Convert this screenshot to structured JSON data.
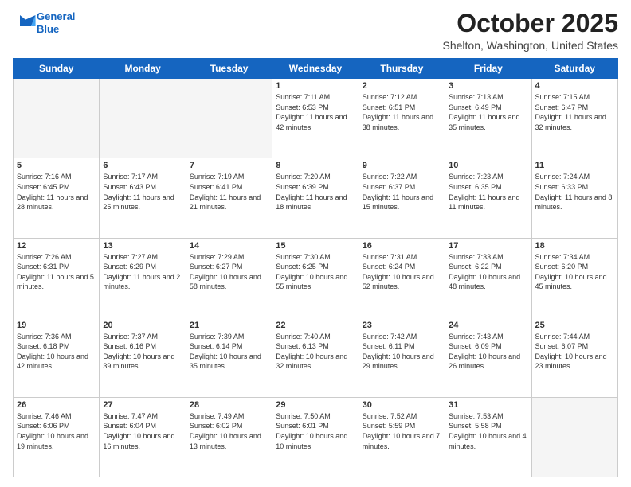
{
  "header": {
    "logo_line1": "General",
    "logo_line2": "Blue",
    "month": "October 2025",
    "location": "Shelton, Washington, United States"
  },
  "days_of_week": [
    "Sunday",
    "Monday",
    "Tuesday",
    "Wednesday",
    "Thursday",
    "Friday",
    "Saturday"
  ],
  "weeks": [
    [
      {
        "day": "",
        "info": ""
      },
      {
        "day": "",
        "info": ""
      },
      {
        "day": "",
        "info": ""
      },
      {
        "day": "1",
        "info": "Sunrise: 7:11 AM\nSunset: 6:53 PM\nDaylight: 11 hours and 42 minutes."
      },
      {
        "day": "2",
        "info": "Sunrise: 7:12 AM\nSunset: 6:51 PM\nDaylight: 11 hours and 38 minutes."
      },
      {
        "day": "3",
        "info": "Sunrise: 7:13 AM\nSunset: 6:49 PM\nDaylight: 11 hours and 35 minutes."
      },
      {
        "day": "4",
        "info": "Sunrise: 7:15 AM\nSunset: 6:47 PM\nDaylight: 11 hours and 32 minutes."
      }
    ],
    [
      {
        "day": "5",
        "info": "Sunrise: 7:16 AM\nSunset: 6:45 PM\nDaylight: 11 hours and 28 minutes."
      },
      {
        "day": "6",
        "info": "Sunrise: 7:17 AM\nSunset: 6:43 PM\nDaylight: 11 hours and 25 minutes."
      },
      {
        "day": "7",
        "info": "Sunrise: 7:19 AM\nSunset: 6:41 PM\nDaylight: 11 hours and 21 minutes."
      },
      {
        "day": "8",
        "info": "Sunrise: 7:20 AM\nSunset: 6:39 PM\nDaylight: 11 hours and 18 minutes."
      },
      {
        "day": "9",
        "info": "Sunrise: 7:22 AM\nSunset: 6:37 PM\nDaylight: 11 hours and 15 minutes."
      },
      {
        "day": "10",
        "info": "Sunrise: 7:23 AM\nSunset: 6:35 PM\nDaylight: 11 hours and 11 minutes."
      },
      {
        "day": "11",
        "info": "Sunrise: 7:24 AM\nSunset: 6:33 PM\nDaylight: 11 hours and 8 minutes."
      }
    ],
    [
      {
        "day": "12",
        "info": "Sunrise: 7:26 AM\nSunset: 6:31 PM\nDaylight: 11 hours and 5 minutes."
      },
      {
        "day": "13",
        "info": "Sunrise: 7:27 AM\nSunset: 6:29 PM\nDaylight: 11 hours and 2 minutes."
      },
      {
        "day": "14",
        "info": "Sunrise: 7:29 AM\nSunset: 6:27 PM\nDaylight: 10 hours and 58 minutes."
      },
      {
        "day": "15",
        "info": "Sunrise: 7:30 AM\nSunset: 6:25 PM\nDaylight: 10 hours and 55 minutes."
      },
      {
        "day": "16",
        "info": "Sunrise: 7:31 AM\nSunset: 6:24 PM\nDaylight: 10 hours and 52 minutes."
      },
      {
        "day": "17",
        "info": "Sunrise: 7:33 AM\nSunset: 6:22 PM\nDaylight: 10 hours and 48 minutes."
      },
      {
        "day": "18",
        "info": "Sunrise: 7:34 AM\nSunset: 6:20 PM\nDaylight: 10 hours and 45 minutes."
      }
    ],
    [
      {
        "day": "19",
        "info": "Sunrise: 7:36 AM\nSunset: 6:18 PM\nDaylight: 10 hours and 42 minutes."
      },
      {
        "day": "20",
        "info": "Sunrise: 7:37 AM\nSunset: 6:16 PM\nDaylight: 10 hours and 39 minutes."
      },
      {
        "day": "21",
        "info": "Sunrise: 7:39 AM\nSunset: 6:14 PM\nDaylight: 10 hours and 35 minutes."
      },
      {
        "day": "22",
        "info": "Sunrise: 7:40 AM\nSunset: 6:13 PM\nDaylight: 10 hours and 32 minutes."
      },
      {
        "day": "23",
        "info": "Sunrise: 7:42 AM\nSunset: 6:11 PM\nDaylight: 10 hours and 29 minutes."
      },
      {
        "day": "24",
        "info": "Sunrise: 7:43 AM\nSunset: 6:09 PM\nDaylight: 10 hours and 26 minutes."
      },
      {
        "day": "25",
        "info": "Sunrise: 7:44 AM\nSunset: 6:07 PM\nDaylight: 10 hours and 23 minutes."
      }
    ],
    [
      {
        "day": "26",
        "info": "Sunrise: 7:46 AM\nSunset: 6:06 PM\nDaylight: 10 hours and 19 minutes."
      },
      {
        "day": "27",
        "info": "Sunrise: 7:47 AM\nSunset: 6:04 PM\nDaylight: 10 hours and 16 minutes."
      },
      {
        "day": "28",
        "info": "Sunrise: 7:49 AM\nSunset: 6:02 PM\nDaylight: 10 hours and 13 minutes."
      },
      {
        "day": "29",
        "info": "Sunrise: 7:50 AM\nSunset: 6:01 PM\nDaylight: 10 hours and 10 minutes."
      },
      {
        "day": "30",
        "info": "Sunrise: 7:52 AM\nSunset: 5:59 PM\nDaylight: 10 hours and 7 minutes."
      },
      {
        "day": "31",
        "info": "Sunrise: 7:53 AM\nSunset: 5:58 PM\nDaylight: 10 hours and 4 minutes."
      },
      {
        "day": "",
        "info": ""
      }
    ]
  ]
}
